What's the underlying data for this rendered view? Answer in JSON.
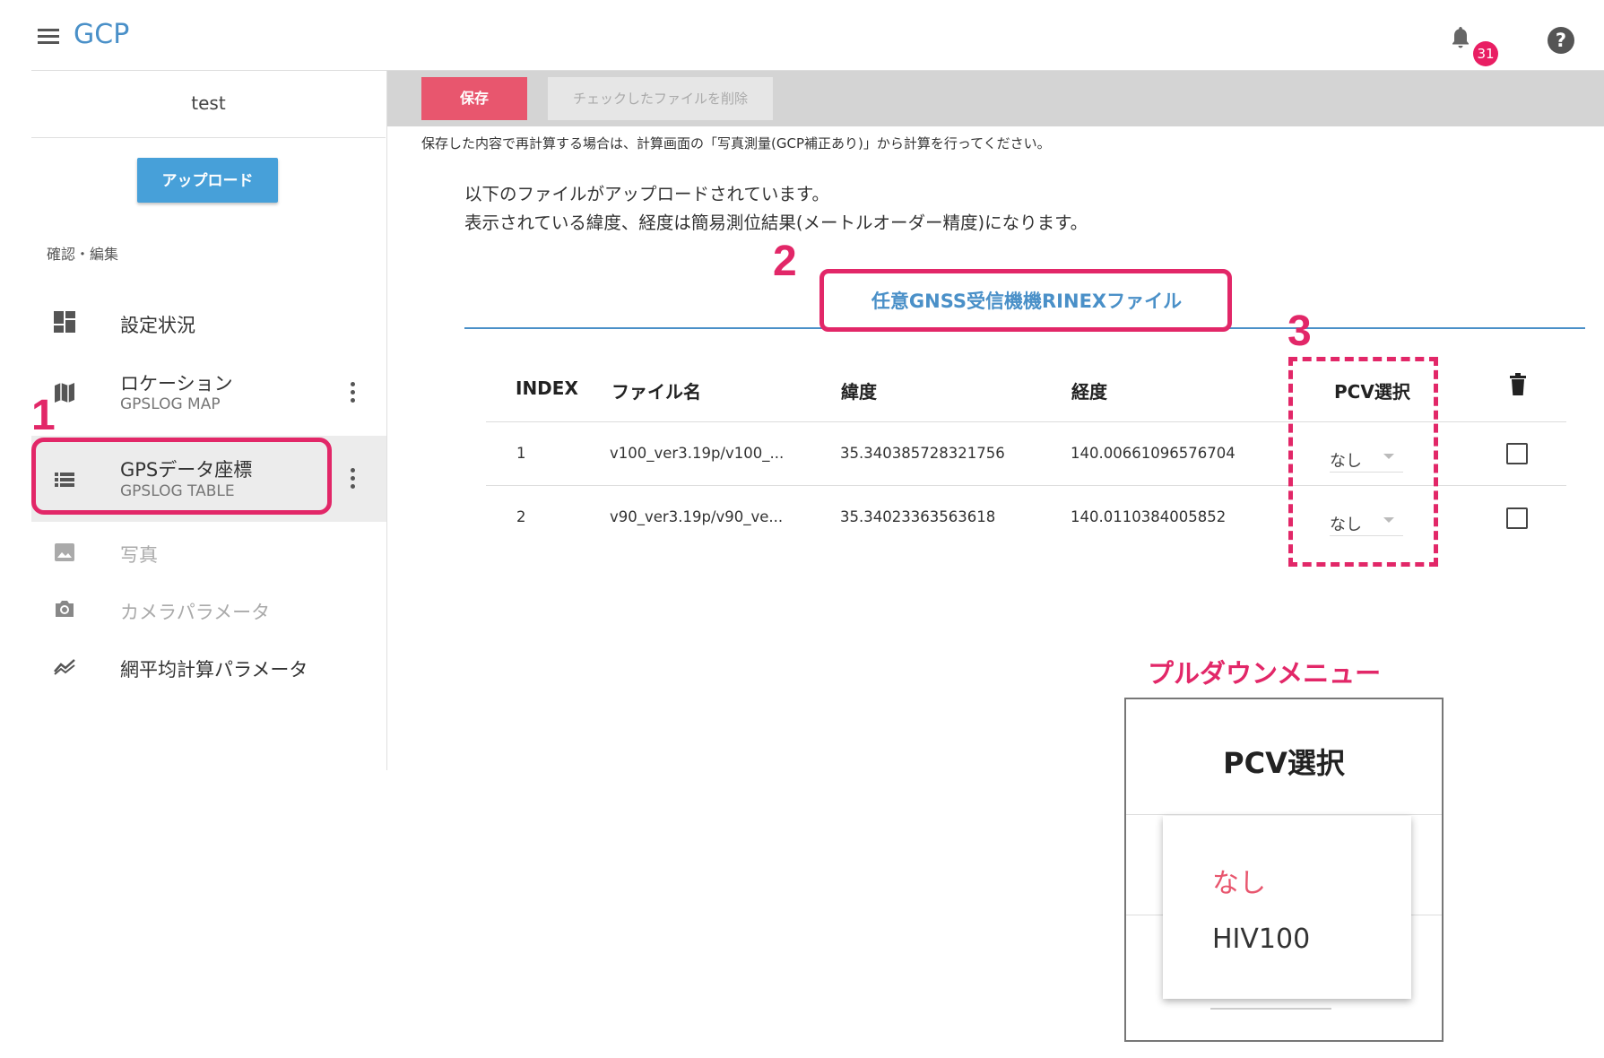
{
  "header": {
    "title": "GCP",
    "notification_count": "31",
    "help_glyph": "?"
  },
  "sidebar": {
    "project_name": "test",
    "upload_label": "アップロード",
    "section_label": "確認・編集",
    "items": [
      {
        "label": "設定状況",
        "icon": "dashboard-icon"
      },
      {
        "label": "ロケーション",
        "sub": "GPSLOG MAP",
        "icon": "map-icon"
      },
      {
        "label": "GPSデータ座標",
        "sub": "GPSLOG TABLE",
        "icon": "list-icon"
      },
      {
        "label": "写真",
        "icon": "photo-icon"
      },
      {
        "label": "カメラパラメータ",
        "icon": "camera-icon"
      },
      {
        "label": "網平均計算パラメータ",
        "icon": "trend-icon"
      }
    ]
  },
  "toolbar": {
    "save_label": "保存",
    "delete_label": "チェックしたファイルを削除"
  },
  "notice": "保存した内容で再計算する場合は、計算画面の「写真測量(GCP補正あり)」から計算を行ってください。",
  "intro": {
    "line1": "以下のファイルがアップロードされています。",
    "line2": "表示されている緯度、経度は簡易測位結果(メートルオーダー精度)になります。"
  },
  "tab": {
    "label": "任意GNSS受信機機RINEXファイル"
  },
  "table": {
    "headers": {
      "index": "INDEX",
      "filename": "ファイル名",
      "lat": "緯度",
      "lon": "経度",
      "pcv": "PCV選択"
    },
    "rows": [
      {
        "index": "1",
        "filename": "v100_ver3.19p/v100_...",
        "lat": "35.340385728321756",
        "lon": "140.00661096576704",
        "pcv": "なし"
      },
      {
        "index": "2",
        "filename": "v90_ver3.19p/v90_ve...",
        "lat": "35.34023363563618",
        "lon": "140.0110384005852",
        "pcv": "なし"
      }
    ]
  },
  "annotations": {
    "n1": "1",
    "n2": "2",
    "n3": "3",
    "accent_color": "#e22768"
  },
  "pulldown": {
    "caption": "プルダウンメニュー",
    "header": "PCV選択",
    "options": [
      "なし",
      "HIV100"
    ]
  }
}
